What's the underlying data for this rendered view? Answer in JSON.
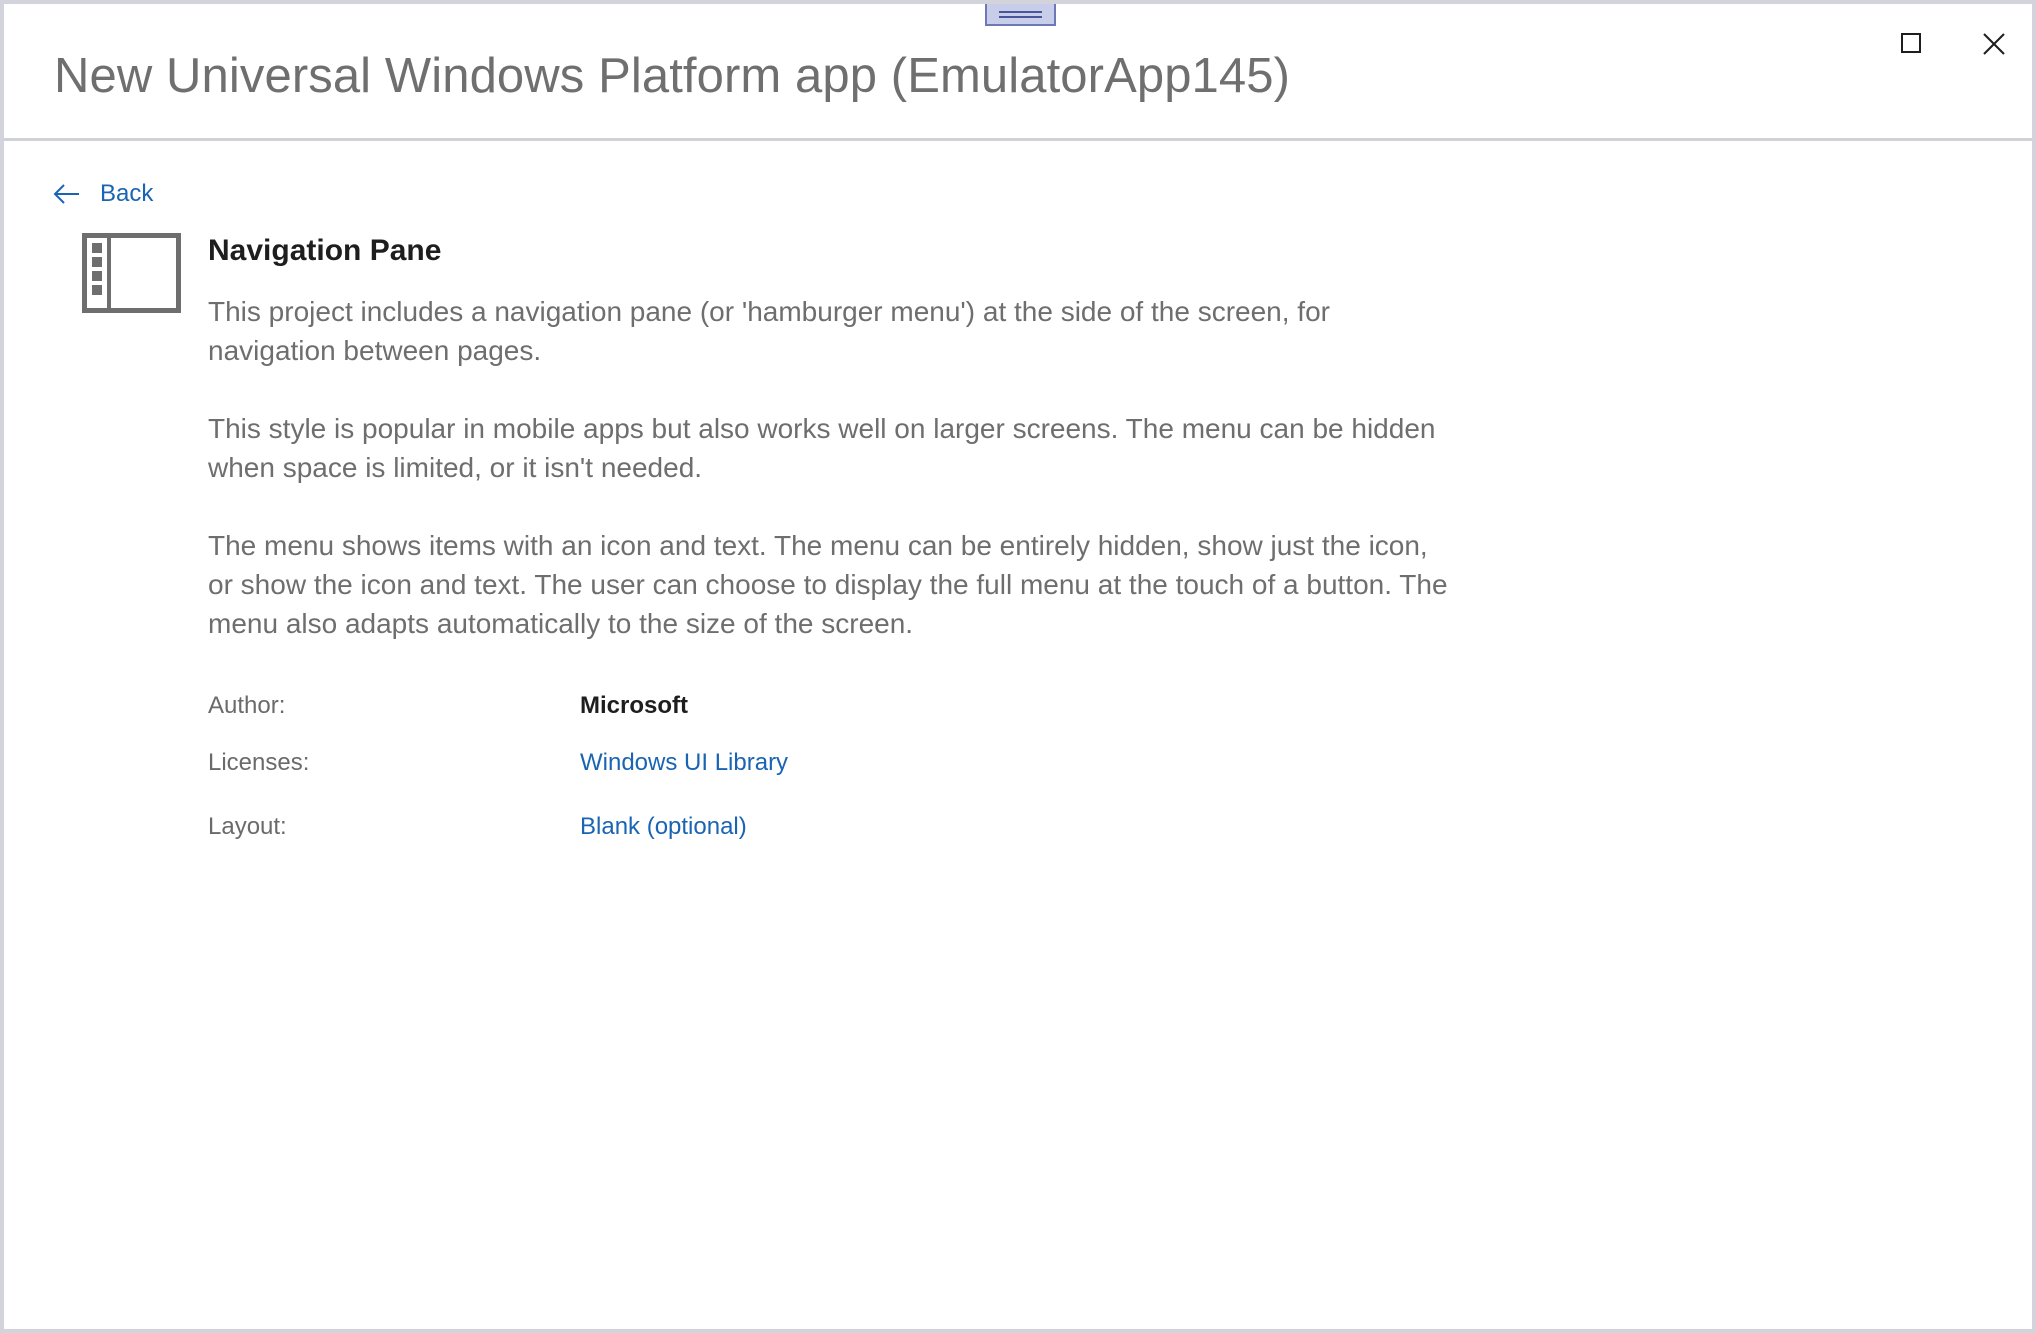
{
  "window": {
    "title": "New Universal Windows Platform app (EmulatorApp145)",
    "maximize_icon": "maximize-icon",
    "close_icon": "close-icon"
  },
  "nav": {
    "back_label": "Back",
    "back_icon": "arrow-left-icon"
  },
  "template": {
    "icon": "navigation-pane-icon",
    "title": "Navigation Pane",
    "paragraphs": [
      "This project includes a navigation pane (or 'hamburger menu') at the side of the screen, for navigation between pages.",
      "This style is popular in mobile apps but also works well on larger screens. The menu can be hidden when space is limited, or it isn't needed.",
      "The menu shows items with an icon and text. The menu can be entirely hidden, show just the icon, or show the icon and text. The user can choose to display the full menu at the touch of a button. The menu also adapts automatically to the size of the screen."
    ]
  },
  "details": {
    "author_label": "Author:",
    "author_value": "Microsoft",
    "licenses_label": "Licenses:",
    "licenses_value": "Windows UI Library",
    "layout_label": "Layout:",
    "layout_value": "Blank (optional)"
  },
  "colors": {
    "link": "#1a64b4",
    "title_text": "#6f6f6f",
    "body_text": "#6e6e6e",
    "heading_text": "#1e1e1e"
  }
}
